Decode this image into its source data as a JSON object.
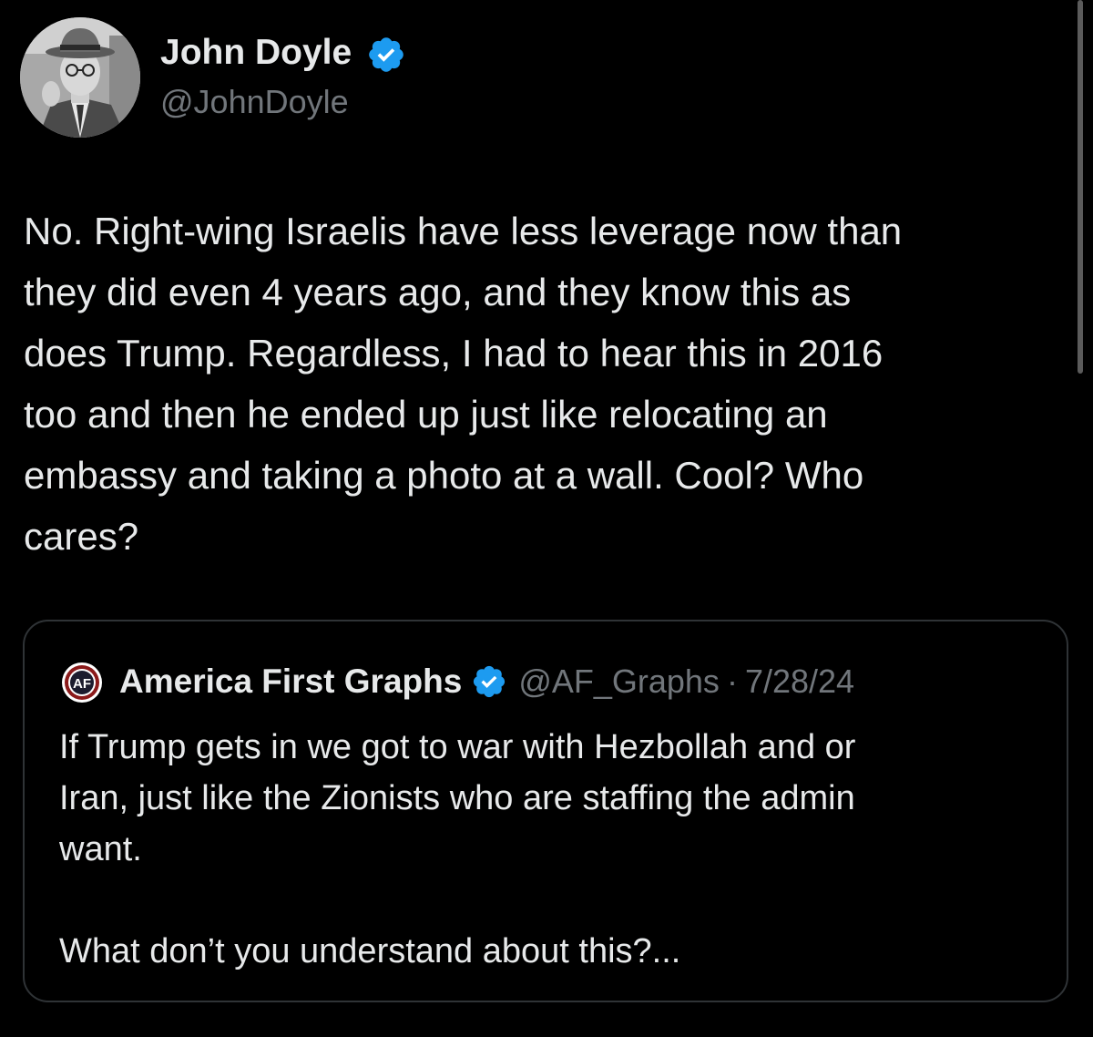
{
  "author": {
    "name": "John Doyle",
    "handle": "@JohnDoyle",
    "verified": true,
    "avatar_icon": "profile-photo-man-in-fedora"
  },
  "tweet": {
    "text": "No. Right-wing Israelis have less leverage now than\nthey did even 4 years ago, and they know this as\ndoes Trump. Regardless, I had to hear this in 2016\ntoo and then he ended up just like relocating an\nembassy and taking a photo at a wall. Cool? Who\ncares?"
  },
  "quoted_tweet": {
    "name": "America First Graphs",
    "handle": "@AF_Graphs",
    "separator": "·",
    "date": "7/28/24",
    "verified": true,
    "avatar_icon": "af-logo-icon",
    "text": "If Trump gets in we got to war with Hezbollah and or\nIran, just like the Zionists who are staffing the admin\nwant.\n\nWhat don’t you understand about this?..."
  },
  "colors": {
    "background": "#000000",
    "text": "#e7e9ea",
    "secondary_text": "#71767b",
    "verified_badge": "#1d9bf0",
    "border": "#2f3336"
  }
}
